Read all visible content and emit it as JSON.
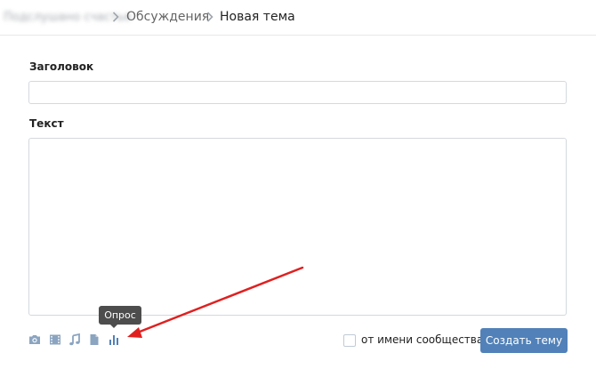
{
  "breadcrumb": {
    "community": "Подслушано счастье",
    "discussions": "Обсуждения",
    "current": "Новая тема"
  },
  "form": {
    "title_label": "Заголовок",
    "title_value": "",
    "text_label": "Текст",
    "text_value": ""
  },
  "toolbar": {
    "icons": [
      "camera-icon",
      "video-icon",
      "music-icon",
      "document-icon",
      "poll-icon"
    ],
    "tooltip": "Опрос"
  },
  "footer": {
    "community_checkbox_label": "от имени сообщества",
    "community_checkbox_checked": false,
    "submit_label": "Создать тему"
  },
  "colors": {
    "accent": "#5181b8",
    "annotation_arrow": "#e02020",
    "icon": "#8ba4c0",
    "tooltip_bg": "#4d4d4d"
  }
}
